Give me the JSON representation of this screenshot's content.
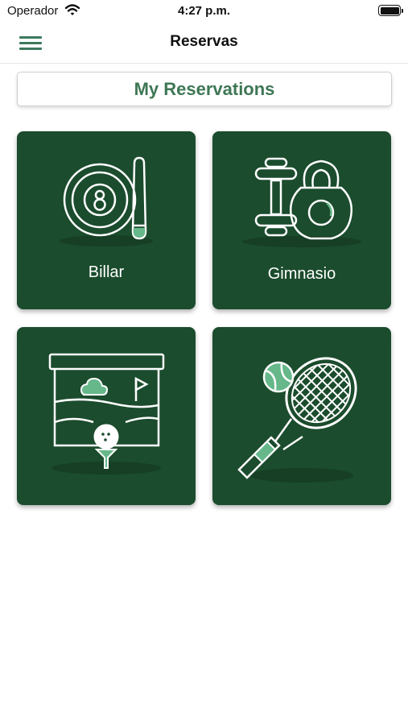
{
  "status_bar": {
    "carrier": "Operador",
    "time": "4:27 p.m."
  },
  "nav": {
    "title": "Reservas",
    "menu_icon": "hamburger-menu-icon"
  },
  "reservations_button": {
    "label": "My Reservations"
  },
  "colors": {
    "tile_background": "#1b4c2d",
    "accent_green": "#3e7755",
    "icon_highlight": "#66b88a"
  },
  "tiles": [
    {
      "label": "Billar",
      "icon": "billiard-ball-cue-icon"
    },
    {
      "label": "Gimnasio",
      "icon": "dumbbell-kettlebell-icon"
    },
    {
      "label": "",
      "icon": "golf-course-icon"
    },
    {
      "label": "",
      "icon": "tennis-racket-ball-icon"
    }
  ]
}
